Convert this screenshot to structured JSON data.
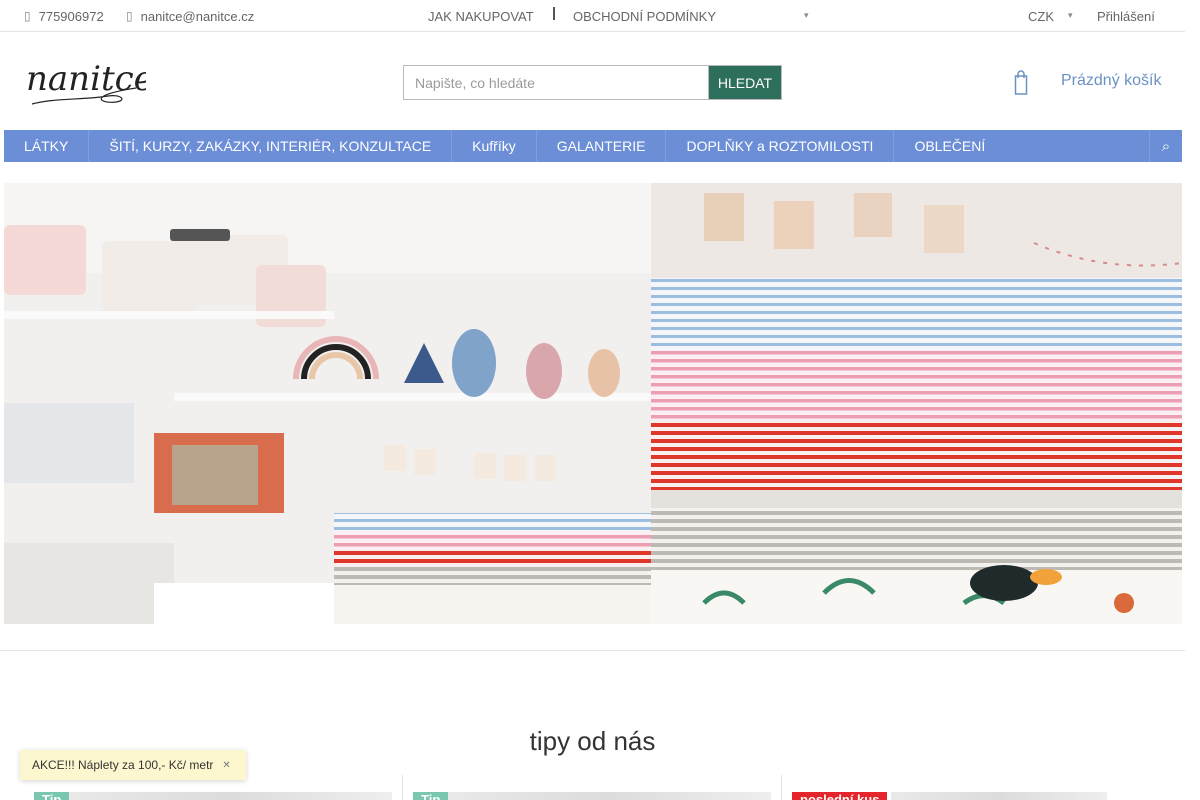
{
  "topbar": {
    "phone": "775906972",
    "email": "nanitce@nanitce.cz",
    "links": [
      "JAK NAKUPOVAT",
      "OBCHODNÍ PODMÍNKY"
    ],
    "currency": "CZK",
    "login": "Přihlášení"
  },
  "header": {
    "logo_text": "nanitce",
    "search_placeholder": "Napište, co hledáte",
    "search_button": "HLEDAT",
    "cart_label": "Prázdný košík"
  },
  "nav": {
    "items": [
      "LÁTKY",
      "ŠITÍ, KURZY, ZAKÁZKY, INTERIÉR, KONZULTACE",
      "Kufříky",
      "GALANTERIE",
      "DOPLŇKY a ROZTOMILOSTI",
      "OBLEČENÍ"
    ]
  },
  "tips": {
    "title": "tipy od nás",
    "cards": [
      {
        "badge": "Tip"
      },
      {
        "badge": "Tip"
      },
      {
        "badge": "poslední kus"
      }
    ]
  },
  "promo": {
    "text": "AKCE!!! Náplety za 100,- Kč/ metr"
  },
  "colors": {
    "nav": "#6b8ed6",
    "search_button": "#2e6e5c",
    "cart": "#6a92c4",
    "badge_tip": "#79c7b1",
    "badge_last": "#e4252c",
    "promo_bg": "#fdf7d0"
  },
  "icons": {
    "phone": "phone-icon",
    "email": "envelope-icon",
    "cart": "cart-icon",
    "search": "search-icon",
    "close": "close-icon"
  }
}
